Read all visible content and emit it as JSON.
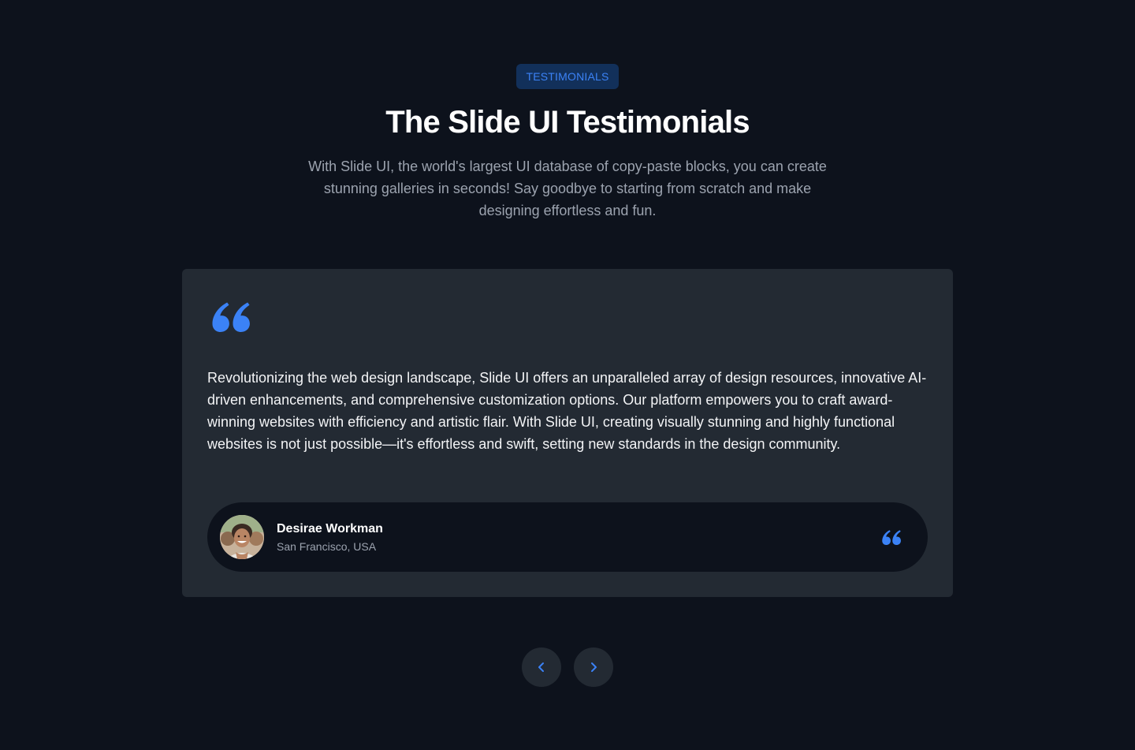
{
  "header": {
    "badge": "TESTIMONIALS",
    "title": "The Slide UI Testimonials",
    "subtitle": "With Slide UI, the world's largest UI database of copy-paste blocks, you can create stunning galleries in seconds! Say goodbye to starting from scratch and make designing effortless and fun."
  },
  "testimonial": {
    "quote_icon": "quote-icon",
    "text": "Revolutionizing the web design landscape, Slide UI offers an unparalleled array of design resources, innovative AI-driven enhancements, and comprehensive customization options. Our platform empowers you to craft award-winning websites with efficiency and artistic flair. With Slide UI, creating visually stunning and highly functional websites is not just possible—it's effortless and swift, setting new standards in the design community.",
    "author": {
      "name": "Desirae Workman",
      "location": "San Francisco, USA",
      "avatar_icon": "avatar"
    }
  },
  "navigation": {
    "prev_icon": "chevron-left-icon",
    "next_icon": "chevron-right-icon"
  },
  "colors": {
    "background": "#0d121c",
    "card": "#232a33",
    "accent": "#3b82f6",
    "badge_bg": "#12305a",
    "muted_text": "#9ca3af"
  }
}
